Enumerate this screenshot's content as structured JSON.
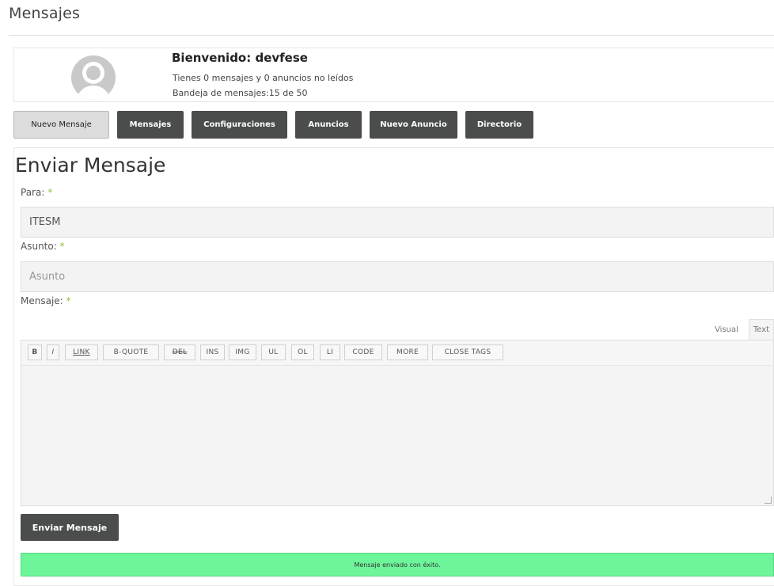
{
  "page": {
    "title": "Mensajes"
  },
  "profile": {
    "welcome": "Bienvenido: devfese",
    "unread_line": "Tienes 0 mensajes y 0 anuncios no leídos",
    "inbox_line": "Bandeja de mensajes:15 de 50"
  },
  "tabs": [
    {
      "label": "Nuevo Mensaje",
      "active": true
    },
    {
      "label": "Mensajes"
    },
    {
      "label": "Configuraciones"
    },
    {
      "label": "Anuncios"
    },
    {
      "label": "Nuevo Anuncio"
    },
    {
      "label": "Directorio"
    }
  ],
  "form": {
    "title": "Enviar Mensaje",
    "to_label": "Para:",
    "to_value": "ITESM",
    "subject_label": "Asunto:",
    "subject_placeholder": "Asunto",
    "message_label": "Mensaje:",
    "required_mark": "*"
  },
  "editor": {
    "modes": [
      "Visual",
      "Text"
    ],
    "quicktags": [
      "B",
      "I",
      "LINK",
      "B-QUOTE",
      "DEL",
      "INS",
      "IMG",
      "UL",
      "OL",
      "LI",
      "CODE",
      "MORE",
      "CLOSE TAGS"
    ]
  },
  "actions": {
    "send_label": "Enviar Mensaje"
  },
  "notice": {
    "text": "Mensaje enviado con éxito."
  },
  "colors": {
    "dark_button": "#4a4d4c",
    "success_bg": "#6df59a",
    "required": "#8fbf3f"
  }
}
